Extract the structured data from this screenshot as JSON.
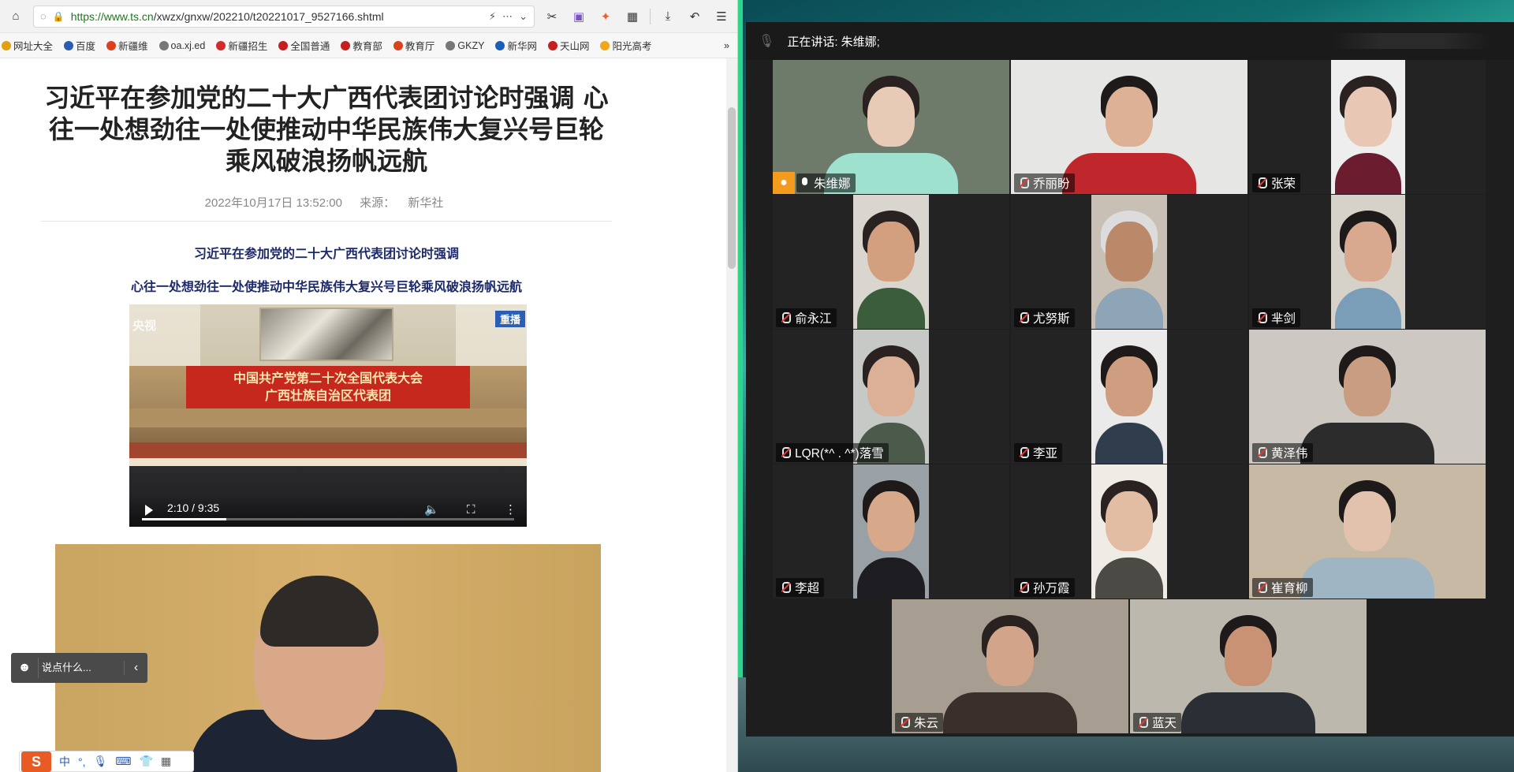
{
  "browser": {
    "url_main": "https://www.ts.cn",
    "url_path": "/xwzx/gnxw/202210/t20221017_9527166.shtml",
    "bookmarks": [
      {
        "label": "网址大全",
        "color": "#e1a012"
      },
      {
        "label": "百度",
        "color": "#2a5db0"
      },
      {
        "label": "新疆维",
        "color": "#d9421c"
      },
      {
        "label": "oa.xj.ed",
        "color": "#777777"
      },
      {
        "label": "新疆招生",
        "color": "#d12b2b"
      },
      {
        "label": "全国普通",
        "color": "#c42020"
      },
      {
        "label": "教育部",
        "color": "#c42020"
      },
      {
        "label": "教育厅",
        "color": "#d9421c"
      },
      {
        "label": "GKZY",
        "color": "#777777"
      },
      {
        "label": "新华网",
        "color": "#1d5fb8"
      },
      {
        "label": "天山网",
        "color": "#c42020"
      },
      {
        "label": "阳光高考",
        "color": "#f0a61d"
      }
    ],
    "bookmarks_more": "»"
  },
  "article": {
    "title": "习近平在参加党的二十大广西代表团讨论时强调 心往一处想劲往一处使推动中华民族伟大复兴号巨轮乘风破浪扬帆远航",
    "date": "2022年10月17日 13:52:00",
    "source_label": "来源：",
    "source": "新华社",
    "subhead1": "习近平在参加党的二十大广西代表团讨论时强调",
    "subhead2": "心往一处想劲往一处使推动中华民族伟大复兴号巨轮乘风破浪扬帆远航",
    "video": {
      "banner_line1": "中国共产党第二十次全国代表大会",
      "banner_line2": "广西壮族自治区代表团",
      "logo_left": "央视",
      "logo_right": "重播",
      "time": "2:10 / 9:35",
      "progress": 0.227
    }
  },
  "comment": {
    "placeholder": "说点什么...",
    "arrow": "‹"
  },
  "ime": {
    "logo": "S",
    "mode": "中",
    "punct": "°,"
  },
  "meeting": {
    "speaking_label": "正在讲话: 朱维娜;",
    "participants": [
      {
        "name": "朱维娜",
        "muted": false,
        "host": true
      },
      {
        "name": "乔丽盼",
        "muted": true
      },
      {
        "name": "张荣",
        "muted": true
      },
      {
        "name": "俞永江",
        "muted": true
      },
      {
        "name": "尤努斯",
        "muted": true
      },
      {
        "name": "芈剑",
        "muted": true
      },
      {
        "name": "LQR(*^ . ^*)落雪",
        "muted": true
      },
      {
        "name": "李亚",
        "muted": true
      },
      {
        "name": "黄泽伟",
        "muted": true
      },
      {
        "name": "李超",
        "muted": true
      },
      {
        "name": "孙万霞",
        "muted": true
      },
      {
        "name": "崔育柳",
        "muted": true
      },
      {
        "name": "朱云",
        "muted": true
      },
      {
        "name": "蓝天",
        "muted": true
      }
    ]
  }
}
